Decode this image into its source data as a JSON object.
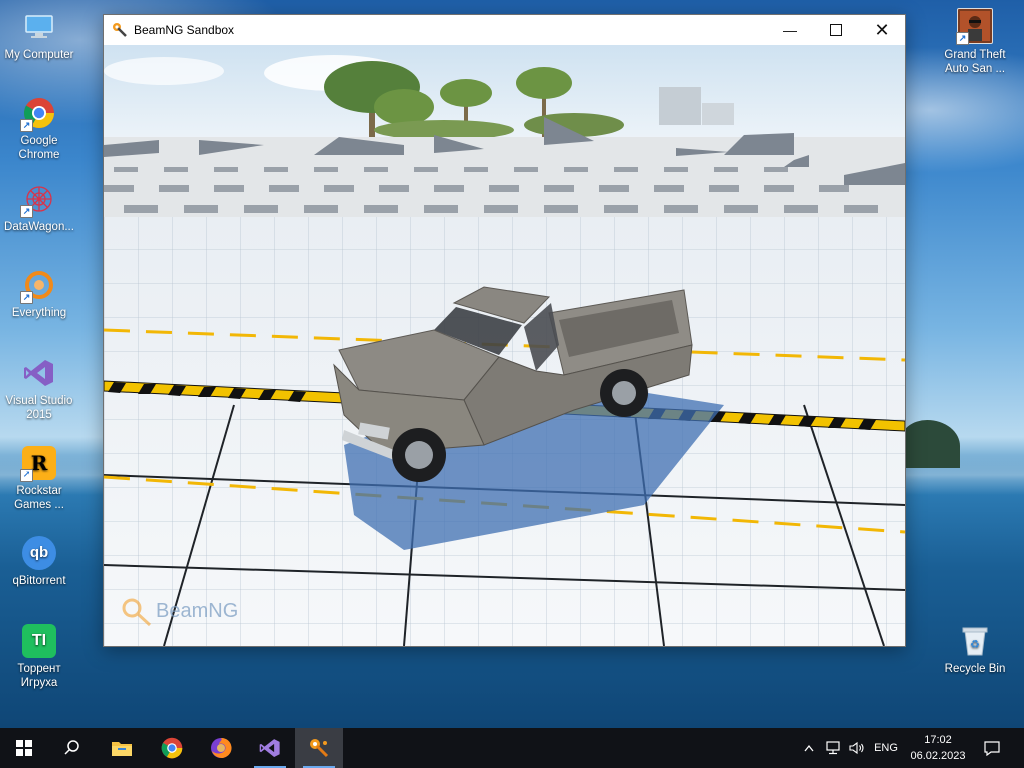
{
  "desktop_icons": [
    {
      "label": "My Computer"
    },
    {
      "label": "Google Chrome"
    },
    {
      "label": "DataWagon..."
    },
    {
      "label": "Everything"
    },
    {
      "label": "Visual Studio 2015"
    },
    {
      "label": "Rockstar Games ..."
    },
    {
      "label": "qBittorrent"
    },
    {
      "label": "Торрент Игруха"
    },
    {
      "label": "Grand Theft Auto San ..."
    },
    {
      "label": "Recycle Bin"
    }
  ],
  "window": {
    "title": "BeamNG Sandbox",
    "watermark": "BeamNG"
  },
  "taskbar": {
    "language": "ENG",
    "time": "17:02",
    "date": "06.02.2023"
  },
  "colors": {
    "taskbar_bg": "#101217",
    "accent": "#6aa9ee",
    "vehicle_body": "#8a8780"
  }
}
